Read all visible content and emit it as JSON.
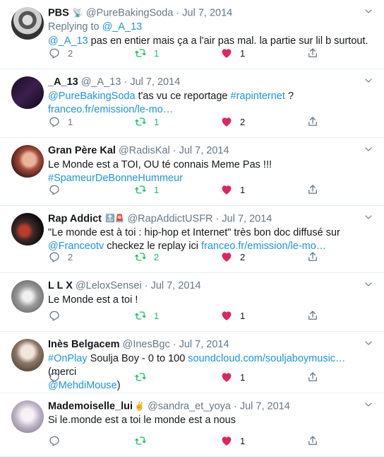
{
  "colors": {
    "link": "#1b95e0",
    "retweet": "#17bf63",
    "like": "#e0245e",
    "muted": "#657786"
  },
  "tweets": [
    {
      "name": "PBS",
      "handle": "@PureBakingSoda",
      "date": "Jul 7, 2014",
      "replying_prefix": "Replying to ",
      "replying_to": "@_A_13",
      "body": [
        {
          "link": "@_A_13"
        },
        {
          "text": " pas en entier mais ça a l'air pas mal. la partie sur lil b surtout."
        }
      ],
      "replies": "2",
      "retweets": "1",
      "likes": "1"
    },
    {
      "name": "_A_13",
      "handle": "@_A_13",
      "date": "Jul 7, 2014",
      "body": [
        {
          "link": "@PureBakingSoda"
        },
        {
          "text": " t'as vu ce reportage "
        },
        {
          "link": "#rapinternet"
        },
        {
          "text": " ?"
        },
        {
          "br": true
        },
        {
          "link": "franceo.fr/emission/le-mo…"
        }
      ],
      "replies": "1",
      "retweets": "1",
      "likes": "2"
    },
    {
      "name": "Gran Père Kal",
      "handle": "@RadisKal",
      "date": "Jul 7, 2014",
      "body": [
        {
          "text": "Le Monde est a TOI, OU té connais Meme Pas !!!"
        },
        {
          "br": true
        },
        {
          "link": "#SpameurDeBonneHummeur"
        }
      ],
      "replies": "",
      "retweets": "1",
      "likes": "1"
    },
    {
      "name": "Rap Addict",
      "handle": "@RapAddictUSFR",
      "date": "Jul 7, 2014",
      "body": [
        {
          "text": "\"Le monde est à toi : hip-hop et Internet\" très bon doc diffusé sur"
        },
        {
          "br": true
        },
        {
          "link": "@Franceotv"
        },
        {
          "text": " checkez le replay ici "
        },
        {
          "link": "franceo.fr/emission/le-mo…"
        }
      ],
      "replies": "2",
      "retweets": "2",
      "likes": "2"
    },
    {
      "name": "L L X",
      "handle": "@LeloxSensei",
      "date": "Jul 7, 2014",
      "body": [
        {
          "text": "Le Monde est a toi !"
        }
      ],
      "replies": "",
      "retweets": "1",
      "likes": "1"
    },
    {
      "name": "Inès Belgacem",
      "handle": "@InesBgc",
      "date": "Jul 7, 2014",
      "body": [
        {
          "link": "#OnPlay"
        },
        {
          "text": " Soulja Boy - 0 to 100 "
        },
        {
          "link": "soundcloud.com/souljaboymusic…"
        },
        {
          "text": " (merci"
        },
        {
          "br": true
        },
        {
          "link": "@MehdiMouse"
        },
        {
          "text": ")"
        }
      ],
      "replies": "",
      "retweets": "",
      "likes": "1"
    },
    {
      "name": "Mademoiselle_lui",
      "handle": "@sandra_et_yoya",
      "date": "Jul 7, 2014",
      "body": [
        {
          "text": "Si le.monde est a toi le monde est a nous"
        }
      ],
      "replies": "",
      "retweets": "",
      "likes": "1"
    }
  ]
}
